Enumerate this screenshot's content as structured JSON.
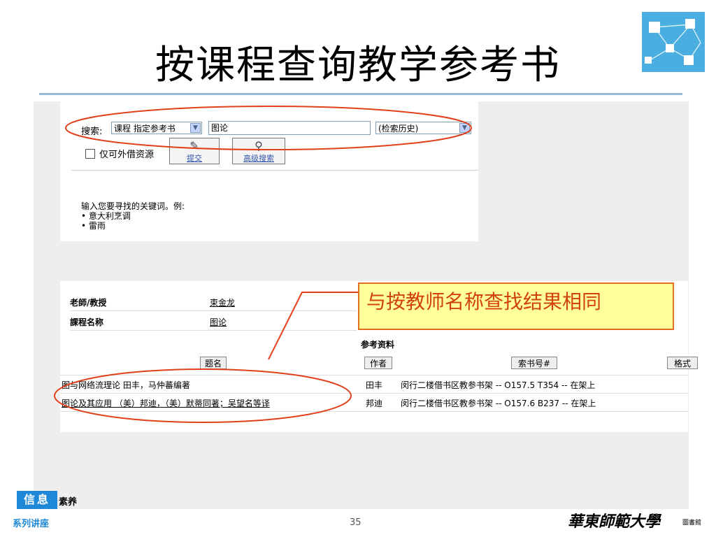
{
  "slide": {
    "title": "按课程查询教学参考书",
    "page_number": "35"
  },
  "search": {
    "label": "搜索:",
    "scope_value": "课程 指定参考书",
    "query_value": "图论",
    "history_value": "(检索历史)",
    "checkbox_label": "仅可外借资源",
    "submit_label": "提交",
    "advanced_label": "高级搜索",
    "hint_intro": "输入您要寻找的关键词。例:",
    "hint_examples": [
      "意大利烹调",
      "雷雨"
    ]
  },
  "results": {
    "teacher_label": "老師/教授",
    "teacher_value": "束金龙",
    "course_label": "課程名称",
    "course_value": "图论",
    "section_label": "参考资料",
    "columns": {
      "title": "题名",
      "author": "作者",
      "call_number": "索书号#",
      "format": "格式"
    },
    "rows": [
      {
        "title": "图与网络流理论 田丰，马仲蕃编著",
        "author": "田丰",
        "location": "闵行二楼借书区教参书架 -- O157.5 T354 -- 在架上"
      },
      {
        "title": "图论及其应用 （美）邦迪，（美）默蒂同著；吴望名等译",
        "author": "邦迪",
        "location": "闵行二楼借书区教参书架 -- O157.6 B237 -- 在架上"
      }
    ]
  },
  "callout": {
    "text": "与按教师名称查找结果相同"
  },
  "footer": {
    "badge": "信息",
    "badge_suffix": "素养",
    "series": "系列讲座",
    "university": "華東師範大學",
    "library": "圖書館"
  },
  "colors": {
    "accent_blue": "#1e88d6",
    "annotation_red": "#e0401a",
    "callout_fill": "#ffff99"
  }
}
